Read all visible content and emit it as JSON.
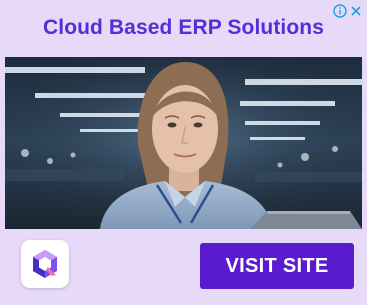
{
  "ad": {
    "headline": "Cloud Based ERP Solutions",
    "cta_label": "VISIT SITE",
    "brand_logo_icon": "q-logo-icon",
    "adchoices": {
      "info_icon": "info-icon",
      "close_icon": "close-icon"
    },
    "colors": {
      "background": "#e6daf8",
      "headline": "#5a2bd6",
      "cta_background": "#5a1bd0",
      "cta_text": "#ffffff",
      "adchoices": "#1aa3e8"
    }
  }
}
